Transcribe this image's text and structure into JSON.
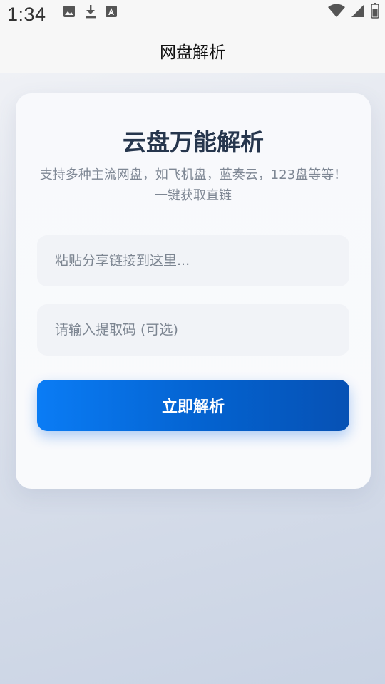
{
  "status_bar": {
    "time": "1:34",
    "left_icons": [
      "image-icon",
      "download-icon",
      "font-a-icon"
    ],
    "right_icons": [
      "wifi-icon",
      "signal-icon",
      "battery-icon"
    ]
  },
  "app_bar": {
    "title": "网盘解析"
  },
  "card": {
    "title": "云盘万能解析",
    "subtitle": "支持多种主流网盘，如飞机盘，蓝奏云，123盘等等！一键获取直链",
    "link_input": {
      "value": "",
      "placeholder": "粘贴分享链接到这里..."
    },
    "code_input": {
      "value": "",
      "placeholder": "请输入提取码 (可选)"
    },
    "submit_label": "立即解析"
  },
  "colors": {
    "title": "#26364d",
    "subtitle": "#7e8794",
    "button_start": "#0a7cf5",
    "button_end": "#0651b4",
    "input_bg": "#f1f3f7"
  }
}
